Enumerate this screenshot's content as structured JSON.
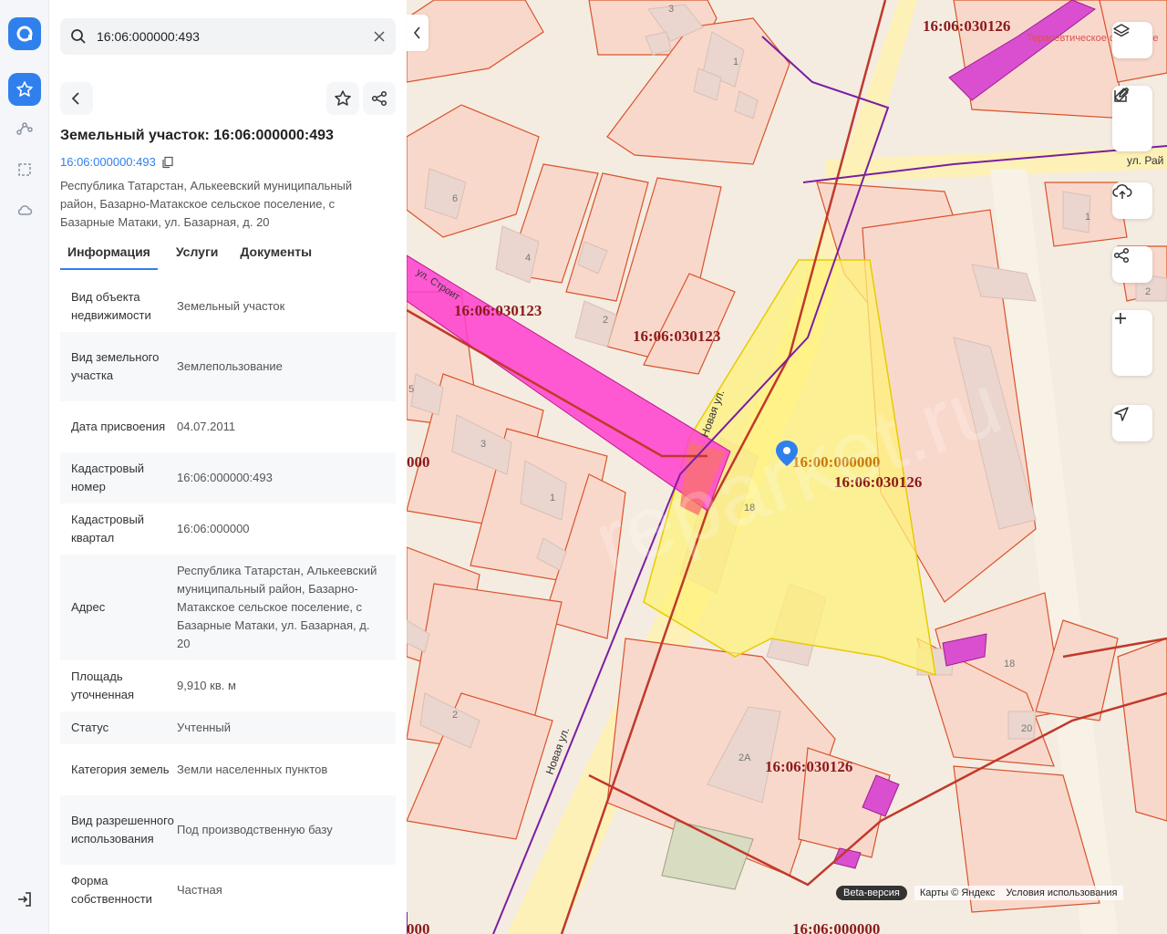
{
  "search": {
    "value": "16:06:000000:493"
  },
  "parcel": {
    "title": "Земельный участок: 16:06:000000:493",
    "cadastral_link": "16:06:000000:493",
    "address": "Республика Татарстан, Алькеевский муниципальный район, Базарно-Матакское сельское поселение, с Базарные Матаки, ул. Базарная, д. 20"
  },
  "tabs": [
    "Информация",
    "Услуги",
    "Документы"
  ],
  "properties": [
    {
      "key": "Вид объекта недвижимости",
      "value": "Земельный участок"
    },
    {
      "key": "Вид земельного участка",
      "value": "Землепользование"
    },
    {
      "key": "Дата присвоения",
      "value": "04.07.2011"
    },
    {
      "key": "Кадастровый номер",
      "value": "16:06:000000:493"
    },
    {
      "key": "Кадастровый квартал",
      "value": "16:06:000000"
    },
    {
      "key": "Адрес",
      "value": "Республика Татарстан, Алькеевский муниципальный район, Базарно-Матакское сельское поселение, с Базарные Матаки, ул. Базарная, д. 20"
    },
    {
      "key": "Площадь уточненная",
      "value": "9,910 кв. м"
    },
    {
      "key": "Статус",
      "value": "Учтенный"
    },
    {
      "key": "Категория земель",
      "value": "Земли населенных пунктов"
    },
    {
      "key": "Вид разрешенного использования",
      "value": "Под производственную базу"
    },
    {
      "key": "Форма собственности",
      "value": "Частная"
    }
  ],
  "map": {
    "labels": {
      "q1": "16:06:030126",
      "q2": "16:06:030123",
      "q3": "16:06:030123",
      "q4": "16:00:000000",
      "q5": "16:06:030126",
      "q6": "16:06:030126",
      "q7": "16:06:000000",
      "q8": "000",
      "q9": "000",
      "street1": "Новая ул.",
      "street2": "Новая ул.",
      "street3": "ул. Строит",
      "street4": "ул. Рай",
      "poi": "Терапевтическое отделение",
      "house_18a": "18",
      "house_18b": "18",
      "house_20": "20",
      "house_2a": "2А",
      "house_1": "1",
      "house_2": "2",
      "house_3": "3",
      "house_4": "4",
      "house_6": "6",
      "house_1b": "1",
      "house_2b": "2",
      "house_3b": "3",
      "house_5": "5",
      "house_1c": "1",
      "house_2c": "2"
    },
    "watermark": "reparket.ru",
    "beta": "Beta-версия",
    "attribution": "Карты © Яндекс",
    "terms": "Условия использования"
  },
  "colors": {
    "accent": "#2f80ed",
    "parcel_fill": "#fff27a",
    "quarter_line": "#c0392b",
    "road_pink": "#ff3fcf"
  }
}
